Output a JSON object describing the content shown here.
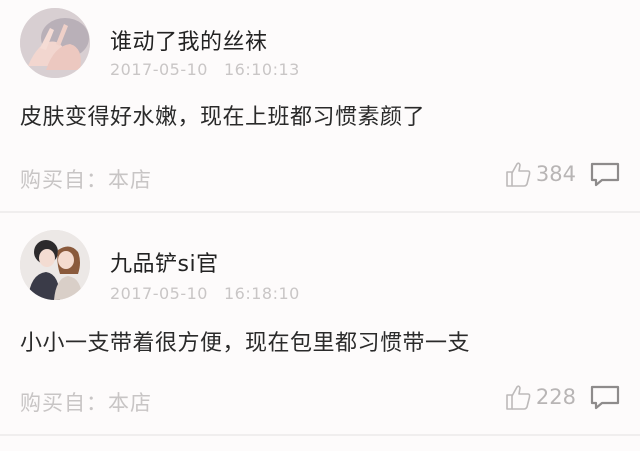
{
  "reviews": [
    {
      "username": "谁动了我的丝袜",
      "date": "2017-05-10",
      "time": "16:10:13",
      "comment": "皮肤变得好水嫩，现在上班都习惯素颜了",
      "purchase_source": "购买自：本店",
      "likes": "384",
      "avatar_icon": "avatar-hands-icon"
    },
    {
      "username": "九品铲si官",
      "date": "2017-05-10",
      "time": "16:18:10",
      "comment": "小小一支带着很方便，现在包里都习惯带一支",
      "purchase_source": "购买自：本店",
      "likes": "228",
      "avatar_icon": "avatar-couple-icon"
    }
  ],
  "colors": {
    "background": "#fdfbfb",
    "username": "#222222",
    "muted": "#c8c5c5",
    "divider": "#f0eeee"
  },
  "icons": [
    "thumbs-up-icon",
    "comment-icon"
  ]
}
